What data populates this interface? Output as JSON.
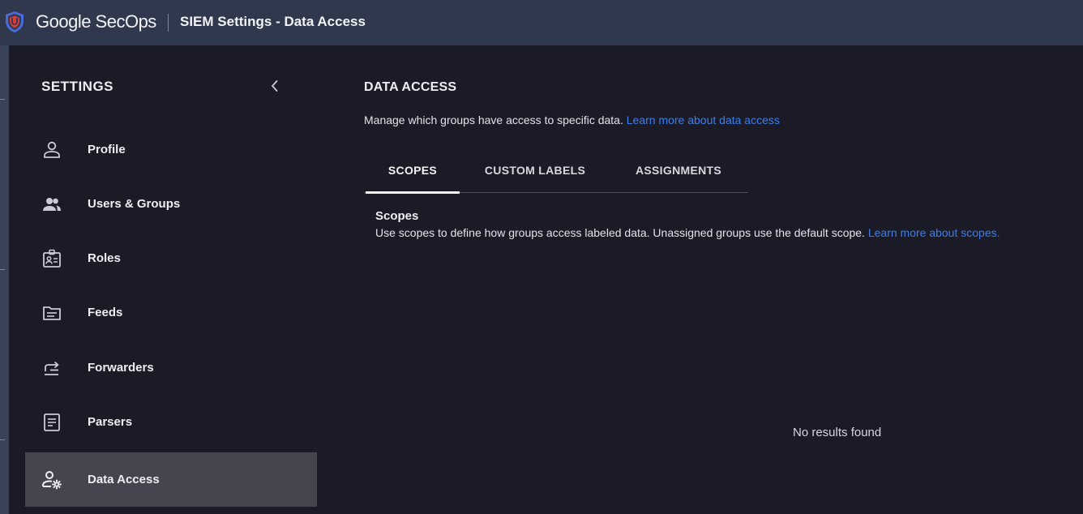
{
  "app": {
    "brand": "Google SecOps",
    "page_title": "SIEM Settings - Data Access"
  },
  "sidebar": {
    "heading": "SETTINGS",
    "items": [
      {
        "label": "Profile",
        "icon": "person-icon"
      },
      {
        "label": "Users & Groups",
        "icon": "group-icon"
      },
      {
        "label": "Roles",
        "icon": "badge-icon"
      },
      {
        "label": "Feeds",
        "icon": "feed-icon"
      },
      {
        "label": "Forwarders",
        "icon": "forward-icon"
      },
      {
        "label": "Parsers",
        "icon": "document-icon"
      },
      {
        "label": "Data Access",
        "icon": "user-gear-icon",
        "active": true
      }
    ]
  },
  "main": {
    "title": "DATA ACCESS",
    "description": "Manage which groups have access to specific data.",
    "description_link": "Learn more about data access",
    "tabs": [
      {
        "label": "SCOPES",
        "active": true
      },
      {
        "label": "CUSTOM LABELS"
      },
      {
        "label": "ASSIGNMENTS"
      }
    ],
    "scopes": {
      "label": "Scopes",
      "description": "Use scopes to define how groups access labeled data. Unassigned groups use the default scope.",
      "link": "Learn more about scopes."
    },
    "empty_state": "No results found"
  },
  "colors": {
    "topbar": "#2f384d",
    "background": "#1a1b26",
    "active_item": "#44454f",
    "link": "#3f7de8",
    "logo_red": "#d93c3c",
    "logo_blue": "#4a6bd8"
  }
}
